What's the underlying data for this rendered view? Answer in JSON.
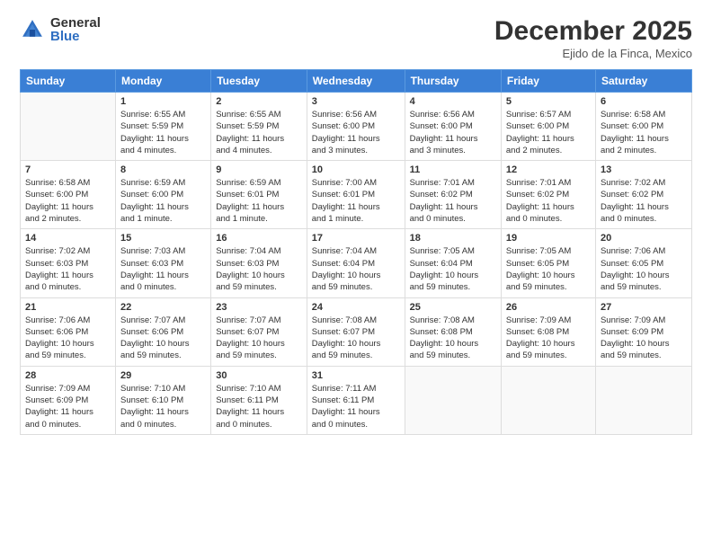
{
  "header": {
    "logo_general": "General",
    "logo_blue": "Blue",
    "month": "December 2025",
    "location": "Ejido de la Finca, Mexico"
  },
  "days_of_week": [
    "Sunday",
    "Monday",
    "Tuesday",
    "Wednesday",
    "Thursday",
    "Friday",
    "Saturday"
  ],
  "weeks": [
    [
      {
        "day": "",
        "info": ""
      },
      {
        "day": "1",
        "info": "Sunrise: 6:55 AM\nSunset: 5:59 PM\nDaylight: 11 hours\nand 4 minutes."
      },
      {
        "day": "2",
        "info": "Sunrise: 6:55 AM\nSunset: 5:59 PM\nDaylight: 11 hours\nand 4 minutes."
      },
      {
        "day": "3",
        "info": "Sunrise: 6:56 AM\nSunset: 6:00 PM\nDaylight: 11 hours\nand 3 minutes."
      },
      {
        "day": "4",
        "info": "Sunrise: 6:56 AM\nSunset: 6:00 PM\nDaylight: 11 hours\nand 3 minutes."
      },
      {
        "day": "5",
        "info": "Sunrise: 6:57 AM\nSunset: 6:00 PM\nDaylight: 11 hours\nand 2 minutes."
      },
      {
        "day": "6",
        "info": "Sunrise: 6:58 AM\nSunset: 6:00 PM\nDaylight: 11 hours\nand 2 minutes."
      }
    ],
    [
      {
        "day": "7",
        "info": "Sunrise: 6:58 AM\nSunset: 6:00 PM\nDaylight: 11 hours\nand 2 minutes."
      },
      {
        "day": "8",
        "info": "Sunrise: 6:59 AM\nSunset: 6:00 PM\nDaylight: 11 hours\nand 1 minute."
      },
      {
        "day": "9",
        "info": "Sunrise: 6:59 AM\nSunset: 6:01 PM\nDaylight: 11 hours\nand 1 minute."
      },
      {
        "day": "10",
        "info": "Sunrise: 7:00 AM\nSunset: 6:01 PM\nDaylight: 11 hours\nand 1 minute."
      },
      {
        "day": "11",
        "info": "Sunrise: 7:01 AM\nSunset: 6:02 PM\nDaylight: 11 hours\nand 0 minutes."
      },
      {
        "day": "12",
        "info": "Sunrise: 7:01 AM\nSunset: 6:02 PM\nDaylight: 11 hours\nand 0 minutes."
      },
      {
        "day": "13",
        "info": "Sunrise: 7:02 AM\nSunset: 6:02 PM\nDaylight: 11 hours\nand 0 minutes."
      }
    ],
    [
      {
        "day": "14",
        "info": "Sunrise: 7:02 AM\nSunset: 6:03 PM\nDaylight: 11 hours\nand 0 minutes."
      },
      {
        "day": "15",
        "info": "Sunrise: 7:03 AM\nSunset: 6:03 PM\nDaylight: 11 hours\nand 0 minutes."
      },
      {
        "day": "16",
        "info": "Sunrise: 7:04 AM\nSunset: 6:03 PM\nDaylight: 10 hours\nand 59 minutes."
      },
      {
        "day": "17",
        "info": "Sunrise: 7:04 AM\nSunset: 6:04 PM\nDaylight: 10 hours\nand 59 minutes."
      },
      {
        "day": "18",
        "info": "Sunrise: 7:05 AM\nSunset: 6:04 PM\nDaylight: 10 hours\nand 59 minutes."
      },
      {
        "day": "19",
        "info": "Sunrise: 7:05 AM\nSunset: 6:05 PM\nDaylight: 10 hours\nand 59 minutes."
      },
      {
        "day": "20",
        "info": "Sunrise: 7:06 AM\nSunset: 6:05 PM\nDaylight: 10 hours\nand 59 minutes."
      }
    ],
    [
      {
        "day": "21",
        "info": "Sunrise: 7:06 AM\nSunset: 6:06 PM\nDaylight: 10 hours\nand 59 minutes."
      },
      {
        "day": "22",
        "info": "Sunrise: 7:07 AM\nSunset: 6:06 PM\nDaylight: 10 hours\nand 59 minutes."
      },
      {
        "day": "23",
        "info": "Sunrise: 7:07 AM\nSunset: 6:07 PM\nDaylight: 10 hours\nand 59 minutes."
      },
      {
        "day": "24",
        "info": "Sunrise: 7:08 AM\nSunset: 6:07 PM\nDaylight: 10 hours\nand 59 minutes."
      },
      {
        "day": "25",
        "info": "Sunrise: 7:08 AM\nSunset: 6:08 PM\nDaylight: 10 hours\nand 59 minutes."
      },
      {
        "day": "26",
        "info": "Sunrise: 7:09 AM\nSunset: 6:08 PM\nDaylight: 10 hours\nand 59 minutes."
      },
      {
        "day": "27",
        "info": "Sunrise: 7:09 AM\nSunset: 6:09 PM\nDaylight: 10 hours\nand 59 minutes."
      }
    ],
    [
      {
        "day": "28",
        "info": "Sunrise: 7:09 AM\nSunset: 6:09 PM\nDaylight: 11 hours\nand 0 minutes."
      },
      {
        "day": "29",
        "info": "Sunrise: 7:10 AM\nSunset: 6:10 PM\nDaylight: 11 hours\nand 0 minutes."
      },
      {
        "day": "30",
        "info": "Sunrise: 7:10 AM\nSunset: 6:11 PM\nDaylight: 11 hours\nand 0 minutes."
      },
      {
        "day": "31",
        "info": "Sunrise: 7:11 AM\nSunset: 6:11 PM\nDaylight: 11 hours\nand 0 minutes."
      },
      {
        "day": "",
        "info": ""
      },
      {
        "day": "",
        "info": ""
      },
      {
        "day": "",
        "info": ""
      }
    ]
  ]
}
